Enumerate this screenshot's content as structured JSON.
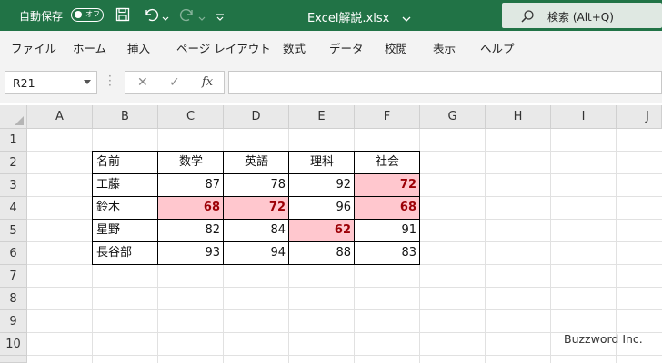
{
  "titlebar": {
    "autosave_label": "自動保存",
    "autosave_toggle": "オフ",
    "filename": "Excel解説.xlsx",
    "search_label": "検索 (Alt+Q)"
  },
  "menu": [
    "ファイル",
    "ホーム",
    "挿入",
    "ページ レイアウト",
    "数式",
    "データ",
    "校閲",
    "表示",
    "ヘルプ"
  ],
  "formula_bar": {
    "name_box": "R21",
    "formula": ""
  },
  "columns": [
    "A",
    "B",
    "C",
    "D",
    "E",
    "F",
    "G",
    "H",
    "I",
    "J"
  ],
  "rows": [
    "1",
    "2",
    "3",
    "4",
    "5",
    "6",
    "7",
    "8",
    "9",
    "10"
  ],
  "table": {
    "headers": [
      "名前",
      "数学",
      "英語",
      "理科",
      "社会"
    ],
    "rows": [
      {
        "name": "工藤",
        "scores": [
          "87",
          "78",
          "92",
          "72"
        ]
      },
      {
        "name": "鈴木",
        "scores": [
          "68",
          "72",
          "96",
          "68"
        ]
      },
      {
        "name": "星野",
        "scores": [
          "82",
          "84",
          "62",
          "91"
        ]
      },
      {
        "name": "長谷部",
        "scores": [
          "93",
          "94",
          "88",
          "83"
        ]
      }
    ]
  },
  "watermark": "Buzzword Inc.",
  "colors": {
    "title_bar": "#217346",
    "highlight_fill": "#ffc7ce",
    "highlight_text": "#9c0006"
  }
}
